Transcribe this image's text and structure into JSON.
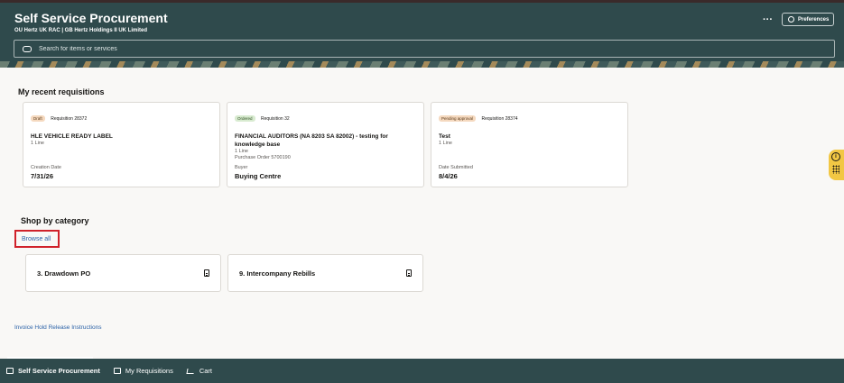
{
  "header": {
    "title": "Self Service Procurement",
    "subtitle": "OU Hertz UK RAC | GB Hertz Holdings II UK Limited",
    "more_label": "···",
    "preferences_label": "Preferences",
    "search_placeholder": "Search for items or services"
  },
  "recent": {
    "title": "My recent requisitions",
    "cards": [
      {
        "status": "Draft",
        "requisition": "Requisition 28372",
        "title": "HLE VEHICLE READY LABEL",
        "lines": [
          "1 Line",
          ""
        ],
        "meta_label": "Creation Date",
        "meta_value": "7/31/26"
      },
      {
        "status": "Ordered",
        "requisition": "Requisition 32",
        "title": "FINANCIAL AUDITORS (NA 8203 SA 82002) - testing for knowledge base",
        "lines": [
          "1 Line",
          "Purchase Order 5700190"
        ],
        "meta_label": "Buyer",
        "meta_value": "Buying Centre"
      },
      {
        "status": "Pending approval",
        "requisition": "Requisition 28374",
        "title": "Test",
        "lines": [
          "1 Line",
          ""
        ],
        "meta_label": "Date Submitted",
        "meta_value": "8/4/26"
      }
    ]
  },
  "shop": {
    "title": "Shop by category",
    "browse_all": "Browse all",
    "categories": [
      {
        "name": "3. Drawdown PO",
        "icon": "document-icon"
      },
      {
        "name": "9. Intercompany Rebills",
        "icon": "document-icon"
      }
    ]
  },
  "invoice_link": "Invoice Hold Release Instructions",
  "side_widget": {
    "info": "i"
  },
  "footer": {
    "items": [
      {
        "label": "Self Service Procurement",
        "icon": "store-icon",
        "active": true
      },
      {
        "label": "My Requisitions",
        "icon": "list-icon",
        "active": false
      },
      {
        "label": "Cart",
        "icon": "cart-icon",
        "active": false
      }
    ]
  },
  "colors": {
    "header_bg": "#2f4a4c",
    "page_bg": "#f9f8f6",
    "link": "#2d63a8",
    "highlight_border": "#d0212a"
  }
}
